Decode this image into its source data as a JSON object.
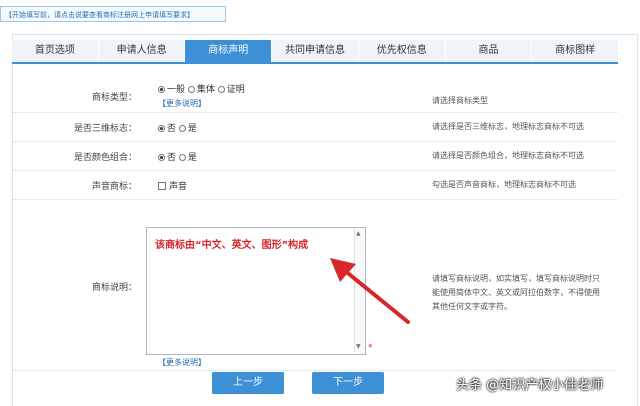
{
  "notice": "【开始填写前，请点击说要查看商标注册网上申请填写要求】",
  "tabs": [
    "首页选项",
    "申请人信息",
    "商标声明",
    "共同申请信息",
    "优先权信息",
    "商品",
    "商标图样"
  ],
  "form": {
    "type": {
      "label": "商标类型：",
      "options": [
        "一般",
        "集体",
        "证明"
      ],
      "selected": "一般",
      "more": "【更多说明】",
      "hint": "请选择商标类型"
    },
    "three_d": {
      "label": "是否三维标志：",
      "options": [
        "否",
        "是"
      ],
      "selected": "否",
      "hint": "请选择是否三维标志，地理标志商标不可选"
    },
    "color": {
      "label": "是否颜色组合：",
      "options": [
        "否",
        "是"
      ],
      "selected": "否",
      "hint": "请选择是否颜色组合，地理标志商标不可选"
    },
    "sound": {
      "label": "声音商标：",
      "checkbox": "声音",
      "hint": "勾选是否声音商标，地理标志商标不可选"
    },
    "description": {
      "label": "商标说明：",
      "value": "该商标由“中文、英文、图形”构成",
      "more": "【更多说明】",
      "required": "*",
      "hint": "请填写商标说明，如实填写，填写商标说明时只能使用简体中文、英文或阿拉伯数字，不得使用其他任何文字或字符。"
    }
  },
  "buttons": {
    "prev": "上一步",
    "next": "下一步"
  },
  "watermark": "头条 @知识产权小佳老师",
  "colors": {
    "accent": "#3d8fd6",
    "annotation": "#d9262b"
  }
}
